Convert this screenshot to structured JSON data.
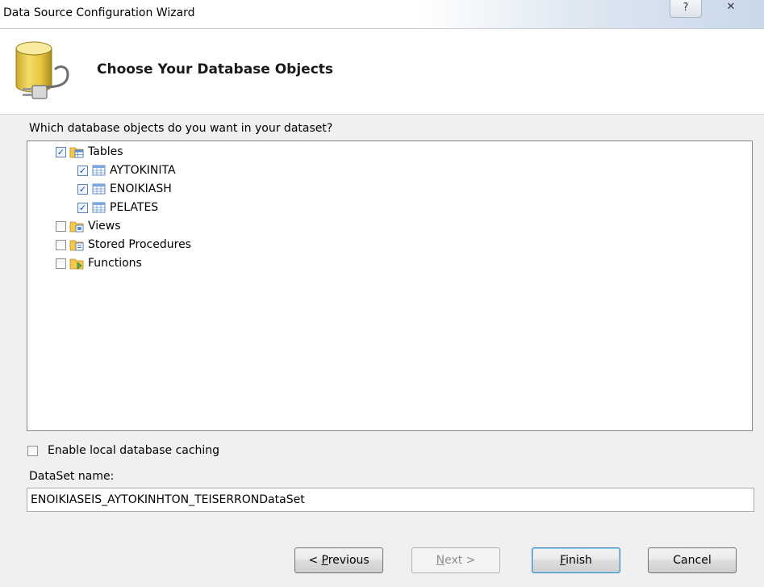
{
  "window": {
    "title": "Data Source Configuration Wizard",
    "help_glyph": "?",
    "close_glyph": "✕"
  },
  "header": {
    "title": "Choose Your Database Objects"
  },
  "objects": {
    "question": "Which database objects do you want in your dataset?",
    "tree": [
      {
        "label": "Tables",
        "checked": true,
        "icon": "tables-folder-icon",
        "children": [
          {
            "label": "AYTOKINITA",
            "checked": true,
            "icon": "table-icon"
          },
          {
            "label": "ENOIKIASH",
            "checked": true,
            "icon": "table-icon"
          },
          {
            "label": "PELATES",
            "checked": true,
            "icon": "table-icon"
          }
        ]
      },
      {
        "label": "Views",
        "checked": false,
        "icon": "views-folder-icon"
      },
      {
        "label": "Stored Procedures",
        "checked": false,
        "icon": "procedures-folder-icon"
      },
      {
        "label": "Functions",
        "checked": false,
        "icon": "functions-folder-icon"
      }
    ]
  },
  "options": {
    "caching_label": "Enable local database caching",
    "caching_checked": false,
    "dataset_label": "DataSet name:",
    "dataset_value": "ENOIKIASEIS_AYTOKINHTON_TEISERRONDataSet"
  },
  "buttons": {
    "previous_prefix": "< ",
    "previous_mnemonic": "P",
    "previous_rest": "revious",
    "next_mnemonic": "N",
    "next_rest": "ext >",
    "finish_mnemonic": "F",
    "finish_rest": "inish",
    "cancel": "Cancel",
    "next_enabled": false
  }
}
